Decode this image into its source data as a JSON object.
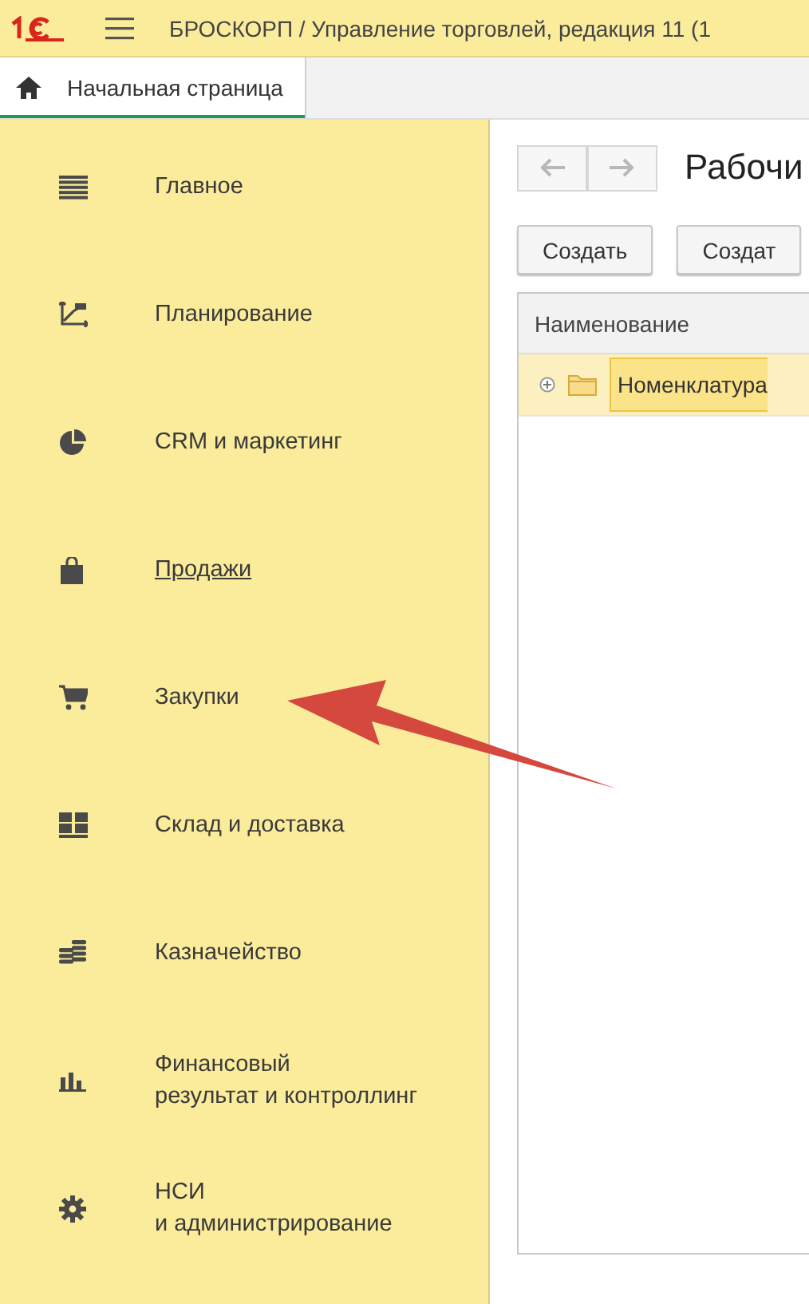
{
  "header": {
    "title": "БРОСКОРП / Управление торговлей, редакция 11  (1"
  },
  "tabs": [
    {
      "label": "Начальная страница",
      "selected": true
    }
  ],
  "sidebar": {
    "items": [
      {
        "kind": "main",
        "label": "Главное",
        "hovered": false
      },
      {
        "kind": "planning",
        "label": "Планирование",
        "hovered": false
      },
      {
        "kind": "crm",
        "label": "CRM и маркетинг",
        "hovered": false
      },
      {
        "kind": "sales",
        "label": "Продажи",
        "hovered": true
      },
      {
        "kind": "purchases",
        "label": "Закупки",
        "hovered": false
      },
      {
        "kind": "warehouse",
        "label": "Склад и доставка",
        "hovered": false
      },
      {
        "kind": "treasury",
        "label": "Казначейство",
        "hovered": false
      },
      {
        "kind": "finance",
        "label": "Финансовый\nрезультат и контроллинг",
        "hovered": false
      },
      {
        "kind": "admin",
        "label": "НСИ\nи администрирование",
        "hovered": false
      }
    ]
  },
  "content": {
    "title": "Рабочи",
    "buttons": [
      "Создать",
      "Создат"
    ],
    "table": {
      "columns": [
        "Наименование"
      ],
      "rows": [
        {
          "name": "Номенклатура",
          "expanded": false,
          "selected": true
        }
      ]
    }
  }
}
